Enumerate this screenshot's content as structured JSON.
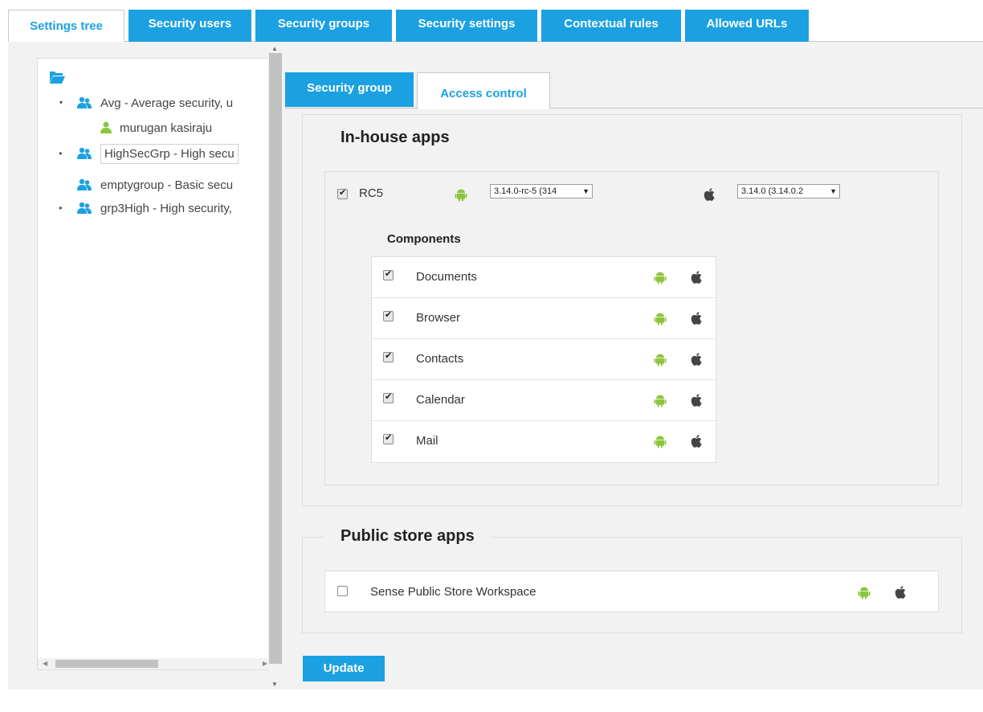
{
  "top_tabs": [
    {
      "label": "Settings tree"
    },
    {
      "label": "Security users"
    },
    {
      "label": "Security groups"
    },
    {
      "label": "Security settings"
    },
    {
      "label": "Contextual rules"
    },
    {
      "label": "Allowed URLs"
    }
  ],
  "tree": {
    "items": [
      {
        "label": "Avg - Average security, u"
      },
      {
        "label": "murugan kasiraju"
      },
      {
        "label": "HighSecGrp - High secu"
      },
      {
        "label": "emptygroup - Basic secu"
      },
      {
        "label": "grp3High - High security,"
      }
    ]
  },
  "sub_tabs": [
    {
      "label": "Security group"
    },
    {
      "label": "Access control"
    }
  ],
  "inhouse": {
    "title": "In-house apps",
    "app": {
      "name": "RC5",
      "checked": true,
      "android_version": "3.14.0-rc-5 (314",
      "ios_version": "3.14.0 (3.14.0.2"
    },
    "components_title": "Components",
    "components": [
      {
        "name": "Documents",
        "checked": true
      },
      {
        "name": "Browser",
        "checked": true
      },
      {
        "name": "Contacts",
        "checked": true
      },
      {
        "name": "Calendar",
        "checked": true
      },
      {
        "name": "Mail",
        "checked": true
      }
    ]
  },
  "public": {
    "title": "Public store apps",
    "app": {
      "name": "Sense Public Store Workspace",
      "checked": false
    }
  },
  "update_label": "Update",
  "colors": {
    "accent": "#1ba1e2",
    "android": "#8cc63f",
    "user_icon": "#1ba1e2",
    "user_single_icon": "#8cc63f"
  }
}
